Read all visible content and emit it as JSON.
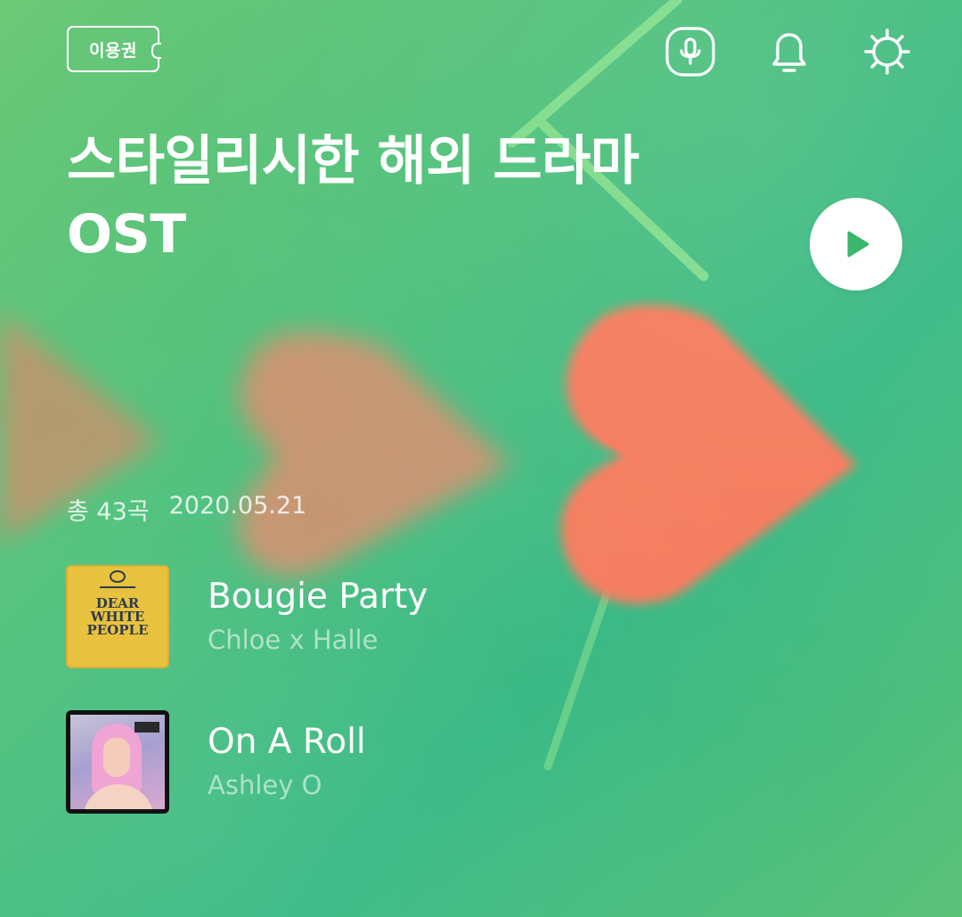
{
  "header": {
    "ticket_label": "이용권",
    "icons": [
      "voice-search-icon",
      "bell-icon",
      "settings-gear-icon"
    ]
  },
  "playlist": {
    "title_line1": "스타일리시한 해외 드라마",
    "title_line2": "OST",
    "track_count": "총 43곡",
    "date": "2020.05.21",
    "play_icon": "play-icon"
  },
  "tracks": [
    {
      "title": "Bougie Party",
      "artist": "Chloe x Halle",
      "cover_text": "DEAR WHITE PEOPLE"
    },
    {
      "title": "On A Roll",
      "artist": "Ashley O"
    }
  ],
  "colors": {
    "background": "#4dc07a",
    "heart": "#f4795a",
    "line": "#7be08a",
    "play_icon": "#3bb76e"
  }
}
